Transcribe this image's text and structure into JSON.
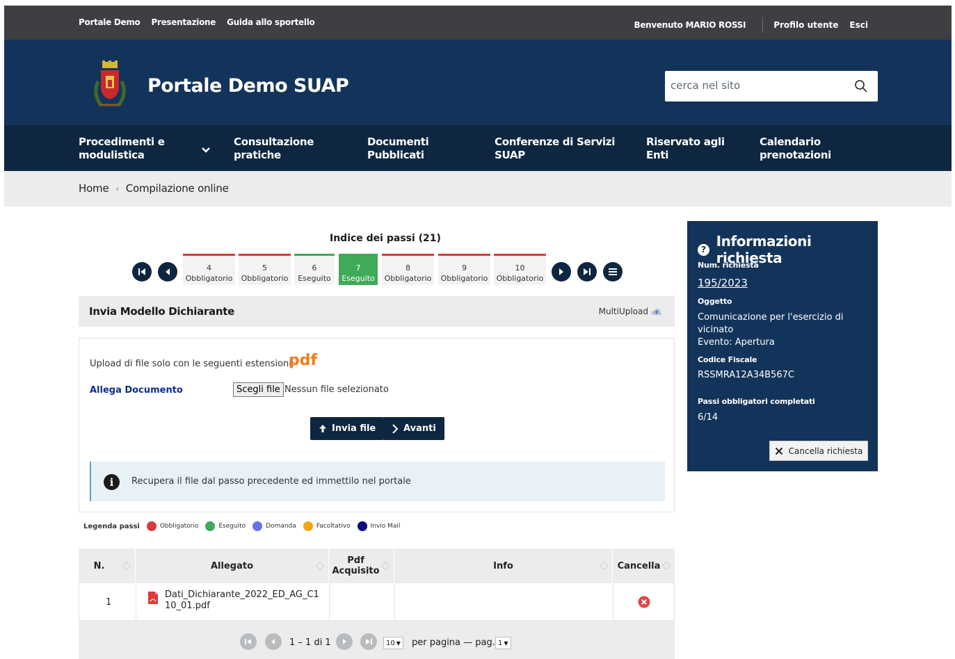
{
  "topbar": {
    "links": [
      "Portale Demo",
      "Presentazione",
      "Guida allo sportello"
    ],
    "welcome_prefix": "Benvenuto",
    "user_name": "MARIO ROSSI",
    "profile_label": "Profilo utente",
    "logout_label": "Esci"
  },
  "header": {
    "title": "Portale Demo SUAP",
    "search_placeholder": "cerca nel sito"
  },
  "nav": {
    "items": [
      "Procedimenti e\nmodulistica",
      "Consultazione\npratiche",
      "Documenti\nPubblicati",
      "Conferenze di Servizi\nSUAP",
      "Riservato agli\nEnti",
      "Calendario\nprenotazioni"
    ]
  },
  "breadcrumb": {
    "home": "Home",
    "current": "Compilazione online"
  },
  "steps": {
    "title": "Indice dei passi (21)",
    "items": [
      {
        "num": "4",
        "status": "Obbligatorio"
      },
      {
        "num": "5",
        "status": "Obbligatorio"
      },
      {
        "num": "6",
        "status": "Eseguito"
      },
      {
        "num": "7",
        "status": "Eseguito"
      },
      {
        "num": "8",
        "status": "Obbligatorio"
      },
      {
        "num": "9",
        "status": "Obbligatorio"
      },
      {
        "num": "10",
        "status": "Obbligatorio"
      }
    ]
  },
  "panel": {
    "title": "Invia Modello Dichiarante",
    "multiupload": "MultiUpload",
    "ext_label": "Upload di file solo con le seguenti estensioni:",
    "ext_value": "pdf",
    "attach_label": "Allega Documento",
    "choose_file": "Scegli file",
    "no_file": "Nessun file selezionato",
    "send_button": "Invia file",
    "next_button": "Avanti",
    "note": "Recupera il file dal passo precedente ed immettilo nel portale"
  },
  "legend": {
    "title": "Legenda passi",
    "items": [
      {
        "label": "Obbligatorio",
        "color": "#d23c3c"
      },
      {
        "label": "Eseguito",
        "color": "#3faa58"
      },
      {
        "label": "Domanda",
        "color": "#6b6ef0"
      },
      {
        "label": "Facoltativo",
        "color": "#f2a516"
      },
      {
        "label": "Invio Mail",
        "color": "#0b0b7a"
      }
    ]
  },
  "table": {
    "headers": [
      "N.",
      "Allegato",
      "Pdf\nAcquisito",
      "Info",
      "Cancella"
    ],
    "rows": [
      {
        "n": "1",
        "allegato": "Dati_Dichiarante_2022_ED_AG_C1\n10_01.pdf",
        "pdf": "",
        "info": ""
      }
    ],
    "pager": {
      "range": "1 – 1 di 1",
      "per_page_value": "10",
      "per_page_label": "per pagina — pag.",
      "page_value": "1"
    }
  },
  "info": {
    "title": "Informazioni richiesta",
    "num_label": "Num. richiesta",
    "num_value": "195/2023",
    "oggetto_label": "Oggetto",
    "oggetto_value": "Comunicazione per l'esercizio di vicinato",
    "evento_value": "Evento: Apertura",
    "cf_label": "Codice Fiscale",
    "cf_value": "RSSMRA12A34B567C",
    "passi_label": "Passi obbligatori completati",
    "passi_value": "6/14",
    "cancel_label": "Cancella richiesta"
  }
}
